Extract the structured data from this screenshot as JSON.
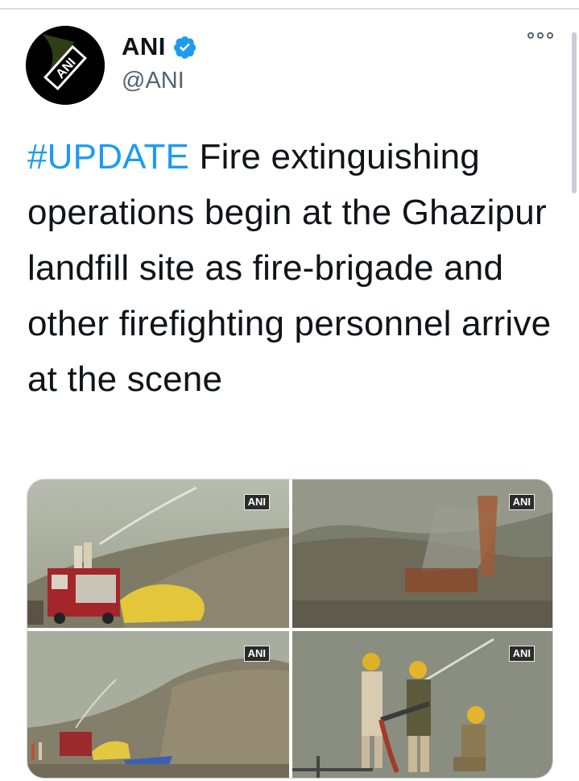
{
  "tweet": {
    "author": {
      "display_name": "ANI",
      "handle": "@ANI",
      "verified": true,
      "avatar_text": "ANI"
    },
    "text": {
      "hashtag": "#UPDATE",
      "body": " Fire extinguishing operations begin at the Ghazipur landfill site as fire-brigade and other firefighting personnel arrive at the scene"
    },
    "media": [
      {
        "watermark": "ANI"
      },
      {
        "watermark": "ANI"
      },
      {
        "watermark": "ANI"
      },
      {
        "watermark": "ANI"
      }
    ]
  },
  "colors": {
    "hashtag": "#1d9bf0",
    "verified_badge": "#1d9bf0",
    "text": "#0f1419",
    "secondary_text": "#536471"
  },
  "icons": {
    "verified": "verified-badge-icon",
    "more": "more-options-icon"
  }
}
